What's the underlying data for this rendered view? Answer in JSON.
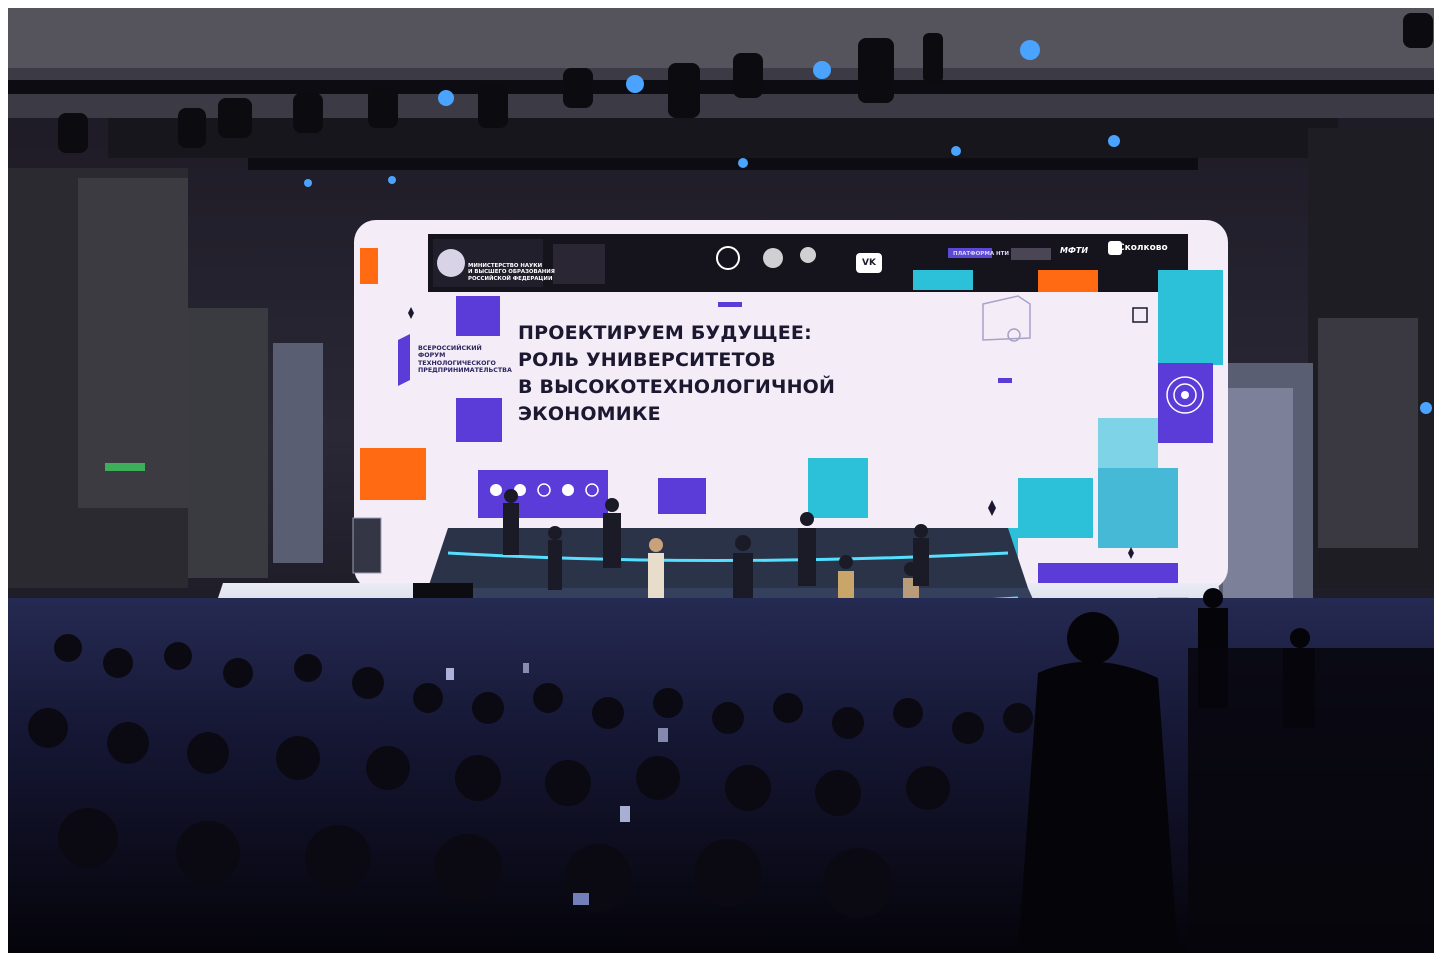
{
  "scene": {
    "description_type": "conference-hall-photo",
    "colors": {
      "screen_bg": "#f4ecf6",
      "accent_purple": "#5c3cd9",
      "accent_orange": "#ff6a13",
      "accent_cyan": "#2cc1d8",
      "hall_dark": "#0a0914"
    }
  },
  "screen": {
    "headline": [
      "ПРОЕКТИРУЕМ БУДУЩЕЕ:",
      "РОЛЬ УНИВЕРСИТЕТОВ",
      "В ВЫСОКОТЕХНОЛОГИЧНОЙ",
      "ЭКОНОМИКЕ"
    ],
    "forum_name": [
      "ВСЕРОССИЙСКИЙ",
      "ФОРУМ",
      "ТЕХНОЛОГИЧЕСКОГО",
      "ПРЕДПРИНИМАТЕЛЬСТВА"
    ],
    "ministry": [
      "МИНИСТЕРСТВО НАУКИ",
      "И ВЫСШЕГО ОБРАЗОВАНИЯ",
      "РОССИЙСКОЙ ФЕДЕРАЦИИ"
    ],
    "logos": {
      "vk": "VK",
      "mfti": "МФТИ",
      "skolkovo": "Сколково",
      "nti": "ПЛАТФОРМА НТИ"
    }
  }
}
